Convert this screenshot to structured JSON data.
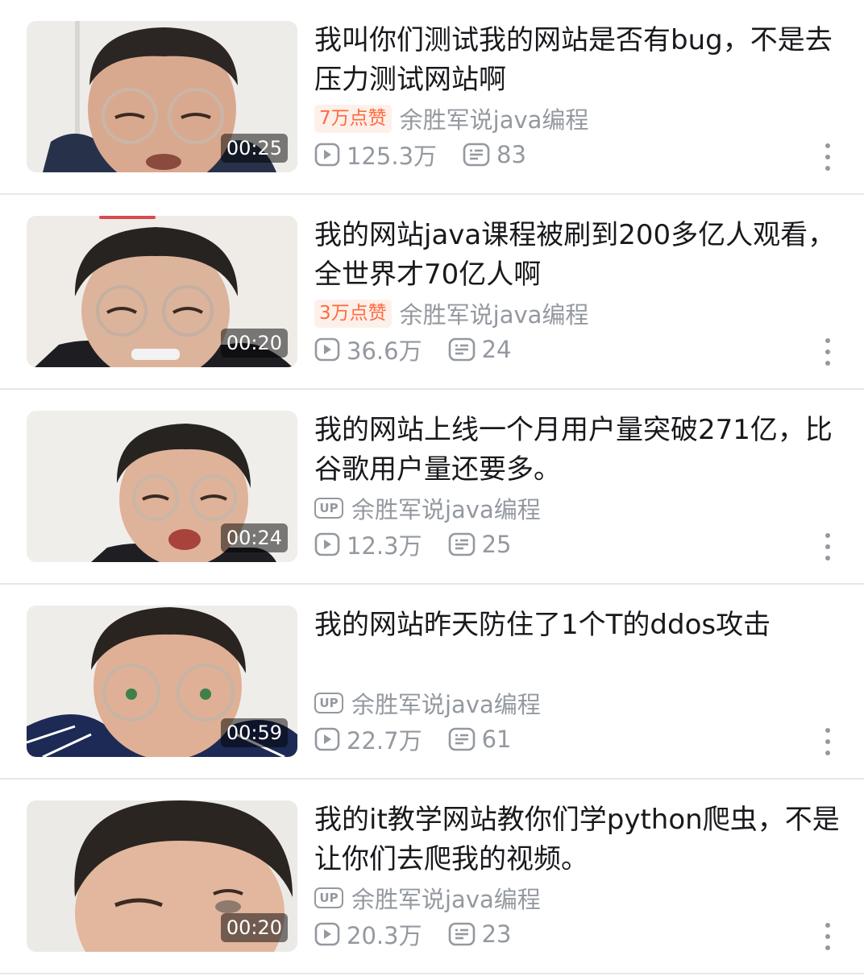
{
  "videos": [
    {
      "title": "我叫你们测试我的网站是否有bug，不是去压力测试网站啊",
      "duration": "00:25",
      "badge": "7万点赞",
      "author": "余胜军说java编程",
      "views": "125.3万",
      "comments": "83"
    },
    {
      "title": "我的网站java课程被刷到200多亿人观看，全世界才70亿人啊",
      "duration": "00:20",
      "badge": "3万点赞",
      "author": "余胜军说java编程",
      "views": "36.6万",
      "comments": "24"
    },
    {
      "title": "我的网站上线一个月用户量突破271亿，比谷歌用户量还要多。",
      "duration": "00:24",
      "up_label": "UP",
      "author": "余胜军说java编程",
      "views": "12.3万",
      "comments": "25"
    },
    {
      "title": "我的网站昨天防住了1个T的ddos攻击",
      "duration": "00:59",
      "up_label": "UP",
      "author": "余胜军说java编程",
      "views": "22.7万",
      "comments": "61"
    },
    {
      "title": "我的it教学网站教你们学python爬虫，不是让你们去爬我的视频。",
      "duration": "00:20",
      "up_label": "UP",
      "author": "余胜军说java编程",
      "views": "20.3万",
      "comments": "23"
    }
  ],
  "icons": {
    "play": "play-count-icon",
    "danmaku": "danmaku-count-icon",
    "more": "more-vertical-icon"
  },
  "colors": {
    "badge_text": "#ff6a3d",
    "badge_bg": "#fdf0ea",
    "meta_gray": "#9499a0",
    "title": "#18191c"
  }
}
